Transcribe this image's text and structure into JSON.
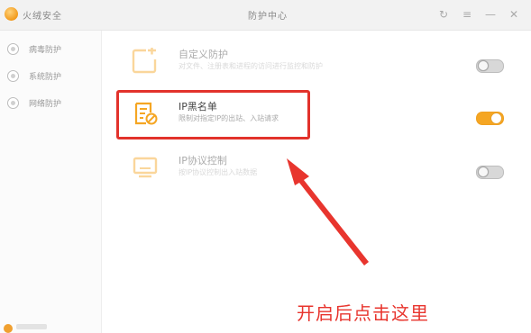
{
  "titlebar": {
    "app_name": "火绒安全",
    "center_title": "防护中心",
    "buttons": [
      {
        "name": "refresh",
        "glyph": "↻"
      },
      {
        "name": "menu",
        "glyph": "≡"
      },
      {
        "name": "minimize",
        "glyph": "—"
      },
      {
        "name": "close",
        "glyph": "✕"
      }
    ]
  },
  "sidebar": {
    "items": [
      {
        "label": "病毒防护",
        "icon": "shield-icon"
      },
      {
        "label": "系统防护",
        "icon": "system-icon"
      },
      {
        "label": "网络防护",
        "icon": "network-icon"
      }
    ]
  },
  "main": {
    "rows": [
      {
        "title": "自定义防护",
        "description": "对文件、注册表和进程的访问进行监控和防护",
        "toggle": "off",
        "icon": "custom-protection-icon"
      },
      {
        "title": "IP黑名单",
        "description": "限制对指定IP的出站、入站请求",
        "toggle": "on",
        "icon": "ip-blacklist-icon"
      },
      {
        "title": "IP协议控制",
        "description": "按IP协议控制出入站数据",
        "toggle": "off",
        "icon": "ip-protocol-icon"
      }
    ]
  },
  "annotation": {
    "text": "开启后点击这里",
    "color": "#e8352e"
  },
  "colors": {
    "accent": "#f5a623",
    "highlight": "#e2322b"
  }
}
